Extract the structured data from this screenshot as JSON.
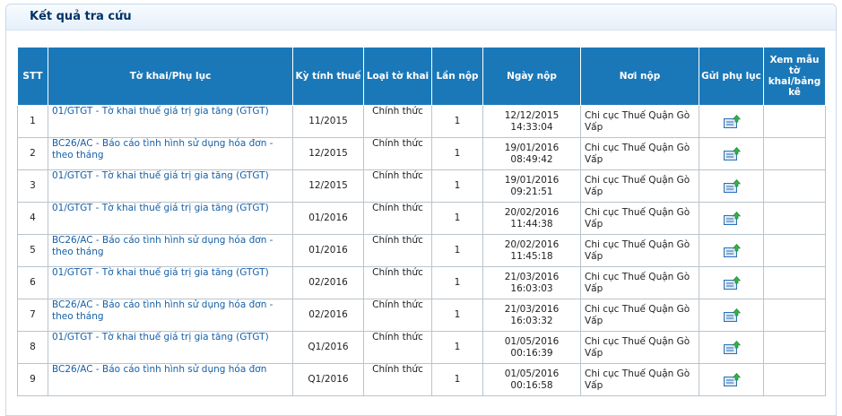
{
  "panel": {
    "title": "Kết quả tra cứu"
  },
  "table": {
    "headers": {
      "stt": "STT",
      "form": "Tờ khai/Phụ lục",
      "period": "Kỳ tính thuế",
      "type": "Loại tờ khai",
      "times": "Lần nộp",
      "date": "Ngày nộp",
      "place": "Nơi nộp",
      "send": "Gửi phụ lục",
      "view": "Xem mẫu tờ khai/bảng kê"
    },
    "rows": [
      {
        "stt": "1",
        "form": "01/GTGT - Tờ khai thuế giá trị gia tăng (GTGT)",
        "period": "11/2015",
        "type": "Chính thức",
        "times": "1",
        "date": "12/12/2015",
        "time": "14:33:04",
        "place": "Chi cục Thuế Quận Gò Vấp"
      },
      {
        "stt": "2",
        "form": "BC26/AC - Báo cáo tình hình sử dụng hóa đơn - theo tháng",
        "period": "12/2015",
        "type": "Chính thức",
        "times": "1",
        "date": "19/01/2016",
        "time": "08:49:42",
        "place": "Chi cục Thuế Quận Gò Vấp"
      },
      {
        "stt": "3",
        "form": "01/GTGT - Tờ khai thuế giá trị gia tăng (GTGT)",
        "period": "12/2015",
        "type": "Chính thức",
        "times": "1",
        "date": "19/01/2016",
        "time": "09:21:51",
        "place": "Chi cục Thuế Quận Gò Vấp"
      },
      {
        "stt": "4",
        "form": "01/GTGT - Tờ khai thuế giá trị gia tăng (GTGT)",
        "period": "01/2016",
        "type": "Chính thức",
        "times": "1",
        "date": "20/02/2016",
        "time": "11:44:38",
        "place": "Chi cục Thuế Quận Gò Vấp"
      },
      {
        "stt": "5",
        "form": "BC26/AC - Báo cáo tình hình sử dụng hóa đơn - theo tháng",
        "period": "01/2016",
        "type": "Chính thức",
        "times": "1",
        "date": "20/02/2016",
        "time": "11:45:18",
        "place": "Chi cục Thuế Quận Gò Vấp"
      },
      {
        "stt": "6",
        "form": "01/GTGT - Tờ khai thuế giá trị gia tăng (GTGT)",
        "period": "02/2016",
        "type": "Chính thức",
        "times": "1",
        "date": "21/03/2016",
        "time": "16:03:03",
        "place": "Chi cục Thuế Quận Gò Vấp"
      },
      {
        "stt": "7",
        "form": "BC26/AC - Báo cáo tình hình sử dụng hóa đơn - theo tháng",
        "period": "02/2016",
        "type": "Chính thức",
        "times": "1",
        "date": "21/03/2016",
        "time": "16:03:32",
        "place": "Chi cục Thuế Quận Gò Vấp"
      },
      {
        "stt": "8",
        "form": "01/GTGT - Tờ khai thuế giá trị gia tăng (GTGT)",
        "period": "Q1/2016",
        "type": "Chính thức",
        "times": "1",
        "date": "01/05/2016",
        "time": "00:16:39",
        "place": "Chi cục Thuế Quận Gò Vấp"
      },
      {
        "stt": "9",
        "form": "BC26/AC - Báo cáo tình hình sử dụng hóa đơn",
        "period": "Q1/2016",
        "type": "Chính thức",
        "times": "1",
        "date": "01/05/2016",
        "time": "00:16:58",
        "place": "Chi cục Thuế Quận Gò Vấp"
      }
    ]
  },
  "icons": {
    "send": "send-appendix-icon"
  },
  "colors": {
    "header_bg": "#1b78b8",
    "link": "#1560a8",
    "title": "#003366"
  }
}
